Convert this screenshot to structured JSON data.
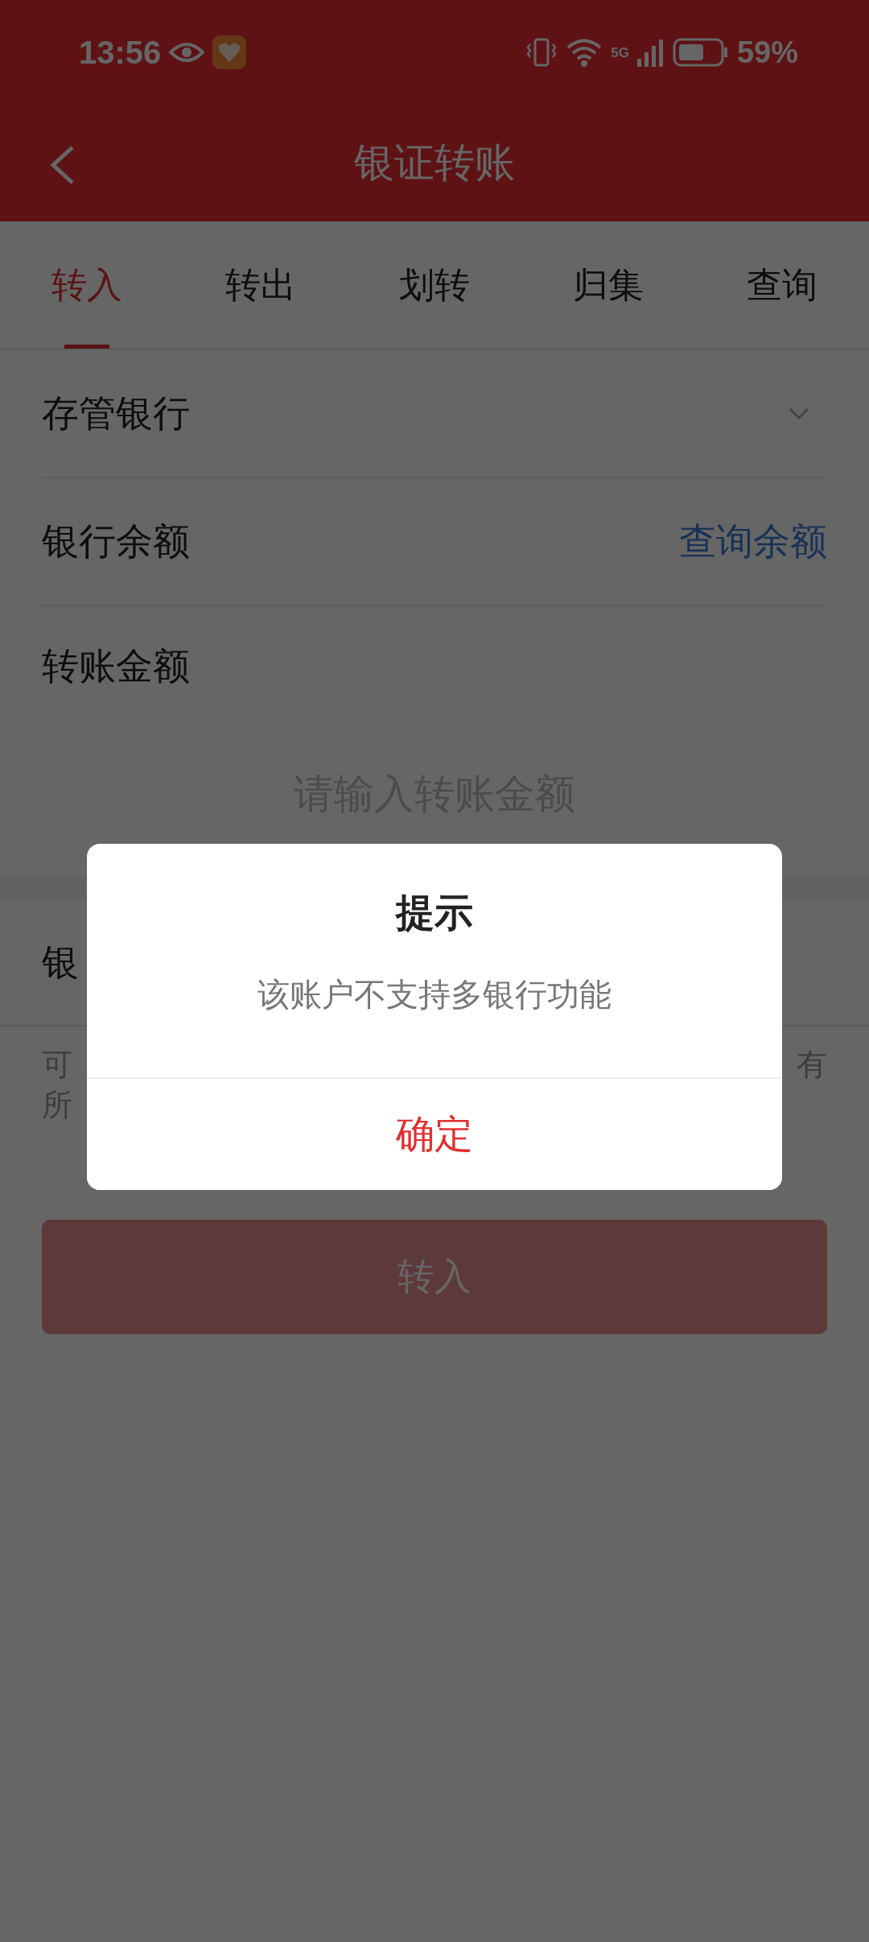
{
  "status_bar": {
    "time": "13:56",
    "network": "5G",
    "battery": "59%"
  },
  "header": {
    "title": "银证转账"
  },
  "tabs": [
    {
      "label": "转入",
      "selected": true
    },
    {
      "label": "转出",
      "selected": false
    },
    {
      "label": "划转",
      "selected": false
    },
    {
      "label": "归集",
      "selected": false
    },
    {
      "label": "查询",
      "selected": false
    }
  ],
  "form": {
    "rows": [
      {
        "kind": "select",
        "label": "存管银行"
      },
      {
        "kind": "action",
        "label": "银行余额",
        "action": "查询余额"
      },
      {
        "kind": "heading",
        "label": "转账金额"
      }
    ],
    "amount": {
      "placeholder": "请输入转账金额"
    }
  },
  "second_row": {
    "label": "银"
  },
  "note": {
    "line_1_left": "可",
    "line_1_right": "有",
    "line_2_left": "所"
  },
  "submit": {
    "label": "转入",
    "disabled": true
  },
  "dialog": {
    "title": "提示",
    "message": "该账户不支持多银行功能",
    "confirm": "确定"
  }
}
